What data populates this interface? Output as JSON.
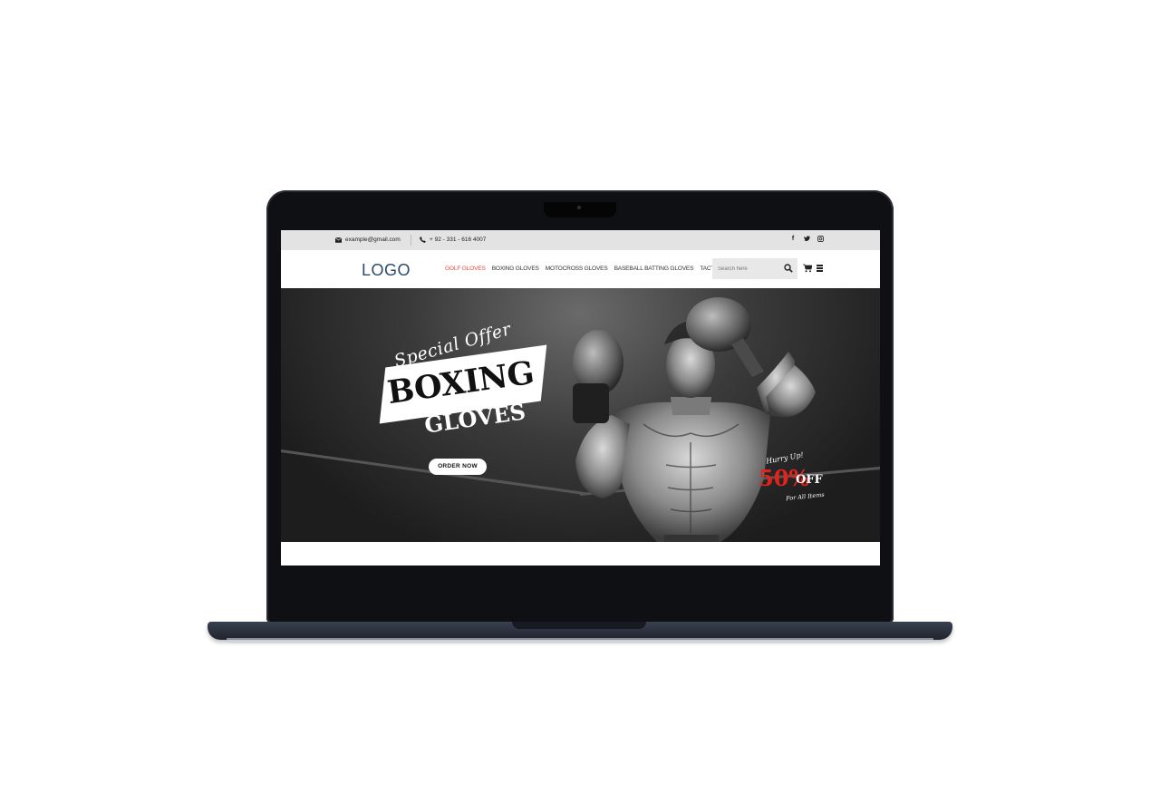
{
  "topbar": {
    "email": "example@gmail.com",
    "phone": "+ 92 - 331 - 616 4007",
    "social_icons": [
      "facebook-icon",
      "twitter-icon",
      "instagram-icon"
    ]
  },
  "nav": {
    "logo": "LOGO",
    "menu": [
      {
        "label": "GOLF GLOVES",
        "active": true
      },
      {
        "label": "BOXING GLOVES",
        "active": false
      },
      {
        "label": "MOTOCROSS GLOVES",
        "active": false
      },
      {
        "label": "BASEBALL BATTING GLOVES",
        "active": false
      },
      {
        "label": "TACTICAL GLOVES",
        "active": false
      }
    ],
    "search_placeholder": "Search here"
  },
  "hero": {
    "tagline": "Special Offer",
    "title_line1": "BOXING",
    "title_line2": "GLOVES",
    "cta": "ORDER NOW",
    "promo": {
      "hurry": "Hurry Up!",
      "percent": "50%",
      "off": "OFF",
      "note": "For All Items"
    }
  },
  "colors": {
    "accent_active": "#e8493f",
    "promo_red": "#e3231b",
    "logo": "#2d4a6b"
  }
}
